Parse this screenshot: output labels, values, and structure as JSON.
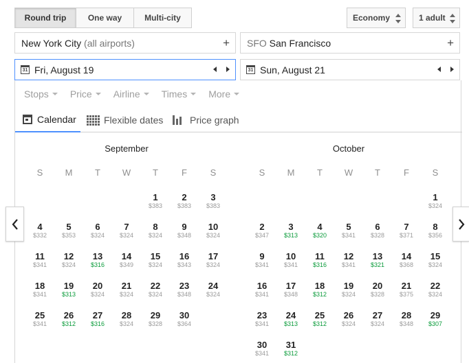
{
  "trip_types": [
    "Round trip",
    "One way",
    "Multi-city"
  ],
  "cabin": "Economy",
  "passengers": "1 adult",
  "origin": {
    "name": "New York City",
    "detail": "(all airports)"
  },
  "destination": {
    "code": "SFO",
    "name": "San Francisco"
  },
  "depart_date": "Fri, August 19",
  "return_date": "Sun, August 21",
  "calendar_icon_text": "31",
  "filters": [
    "Stops",
    "Price",
    "Airline",
    "Times",
    "More"
  ],
  "tabs": [
    "Calendar",
    "Flexible dates",
    "Price graph"
  ],
  "weekdays": [
    "S",
    "M",
    "T",
    "W",
    "T",
    "F",
    "S"
  ],
  "months": [
    {
      "name": "September",
      "first_weekday": 4,
      "days": [
        {
          "d": "1",
          "p": "$383"
        },
        {
          "d": "2",
          "p": "$383"
        },
        {
          "d": "3",
          "p": "$383"
        },
        {
          "d": "4",
          "p": "$332"
        },
        {
          "d": "5",
          "p": "$353"
        },
        {
          "d": "6",
          "p": "$324"
        },
        {
          "d": "7",
          "p": "$324"
        },
        {
          "d": "8",
          "p": "$324"
        },
        {
          "d": "9",
          "p": "$348"
        },
        {
          "d": "10",
          "p": "$324"
        },
        {
          "d": "11",
          "p": "$341"
        },
        {
          "d": "12",
          "p": "$324"
        },
        {
          "d": "13",
          "p": "$316",
          "low": true
        },
        {
          "d": "14",
          "p": "$349"
        },
        {
          "d": "15",
          "p": "$324"
        },
        {
          "d": "16",
          "p": "$343"
        },
        {
          "d": "17",
          "p": "$324"
        },
        {
          "d": "18",
          "p": "$341"
        },
        {
          "d": "19",
          "p": "$313",
          "low": true
        },
        {
          "d": "20",
          "p": "$324"
        },
        {
          "d": "21",
          "p": "$324"
        },
        {
          "d": "22",
          "p": "$324"
        },
        {
          "d": "23",
          "p": "$348"
        },
        {
          "d": "24",
          "p": "$324"
        },
        {
          "d": "25",
          "p": "$341"
        },
        {
          "d": "26",
          "p": "$312",
          "low": true
        },
        {
          "d": "27",
          "p": "$316",
          "low": true
        },
        {
          "d": "28",
          "p": "$324"
        },
        {
          "d": "29",
          "p": "$328"
        },
        {
          "d": "30",
          "p": "$364"
        }
      ]
    },
    {
      "name": "October",
      "first_weekday": 6,
      "days": [
        {
          "d": "1",
          "p": "$324"
        },
        {
          "d": "2",
          "p": "$347"
        },
        {
          "d": "3",
          "p": "$313",
          "low": true
        },
        {
          "d": "4",
          "p": "$320",
          "low": true
        },
        {
          "d": "5",
          "p": "$341"
        },
        {
          "d": "6",
          "p": "$328"
        },
        {
          "d": "7",
          "p": "$371"
        },
        {
          "d": "8",
          "p": "$356"
        },
        {
          "d": "9",
          "p": "$341"
        },
        {
          "d": "10",
          "p": "$341"
        },
        {
          "d": "11",
          "p": "$316",
          "low": true
        },
        {
          "d": "12",
          "p": "$341"
        },
        {
          "d": "13",
          "p": "$321",
          "low": true
        },
        {
          "d": "14",
          "p": "$368"
        },
        {
          "d": "15",
          "p": "$324"
        },
        {
          "d": "16",
          "p": "$341"
        },
        {
          "d": "17",
          "p": "$348"
        },
        {
          "d": "18",
          "p": "$312",
          "low": true
        },
        {
          "d": "19",
          "p": "$324"
        },
        {
          "d": "20",
          "p": "$328"
        },
        {
          "d": "21",
          "p": "$375"
        },
        {
          "d": "22",
          "p": "$324"
        },
        {
          "d": "23",
          "p": "$341"
        },
        {
          "d": "24",
          "p": "$313",
          "low": true
        },
        {
          "d": "25",
          "p": "$312",
          "low": true
        },
        {
          "d": "26",
          "p": "$324"
        },
        {
          "d": "27",
          "p": "$324"
        },
        {
          "d": "28",
          "p": "$348"
        },
        {
          "d": "29",
          "p": "$307",
          "low": true
        },
        {
          "d": "30",
          "p": "$341"
        },
        {
          "d": "31",
          "p": "$312",
          "low": true
        }
      ]
    }
  ],
  "colors": {
    "low_price": "#0a9b3a",
    "accent": "#4d90fe"
  }
}
